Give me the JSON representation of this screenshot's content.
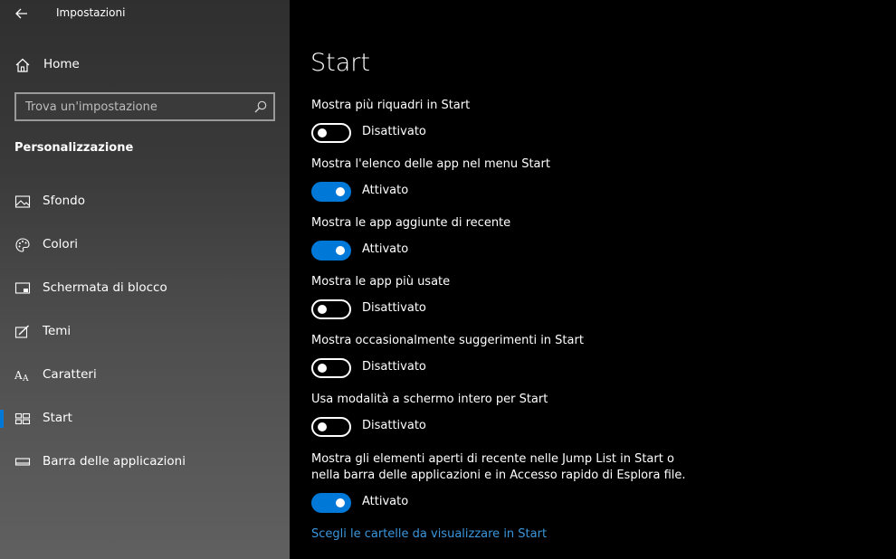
{
  "window": {
    "title": "Impostazioni"
  },
  "sidebar": {
    "home_label": "Home",
    "search_placeholder": "Trova un'impostazione",
    "section_title": "Personalizzazione",
    "items": [
      {
        "label": "Sfondo",
        "icon": "picture-icon"
      },
      {
        "label": "Colori",
        "icon": "palette-icon"
      },
      {
        "label": "Schermata di blocco",
        "icon": "lock-screen-icon"
      },
      {
        "label": "Temi",
        "icon": "themes-brush-icon"
      },
      {
        "label": "Caratteri",
        "icon": "font-icon"
      },
      {
        "label": "Start",
        "icon": "start-tiles-icon",
        "active": true
      },
      {
        "label": "Barra delle applicazioni",
        "icon": "taskbar-icon"
      }
    ]
  },
  "main": {
    "title": "Start",
    "settings": [
      {
        "label": "Mostra più riquadri in Start",
        "state": "Disattivato",
        "on": false
      },
      {
        "label": "Mostra l'elenco delle app nel menu Start",
        "state": "Attivato",
        "on": true
      },
      {
        "label": "Mostra le app aggiunte di recente",
        "state": "Attivato",
        "on": true
      },
      {
        "label": "Mostra le app più usate",
        "state": "Disattivato",
        "on": false
      },
      {
        "label": "Mostra occasionalmente suggerimenti in Start",
        "state": "Disattivato",
        "on": false
      },
      {
        "label": "Usa modalità a schermo intero per Start",
        "state": "Disattivato",
        "on": false
      },
      {
        "label": "Mostra gli elementi aperti di recente nelle Jump List in Start o nella barra delle applicazioni e in Accesso rapido di Esplora file.",
        "state": "Attivato",
        "on": true
      }
    ],
    "link_label": "Scegli le cartelle da visualizzare in Start"
  },
  "colors": {
    "accent": "#0078d7",
    "link": "#3a96dd"
  }
}
